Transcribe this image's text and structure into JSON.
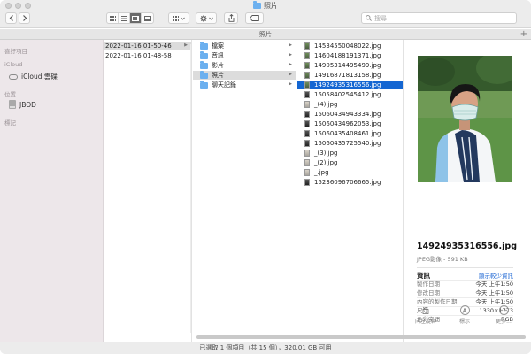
{
  "window": {
    "title": "照片"
  },
  "toolbar": {
    "back_icon": "chevron-left-icon",
    "forward_icon": "chevron-right-icon",
    "view_modes": [
      "icon-view",
      "list-view",
      "column-view",
      "gallery-view"
    ],
    "active_view": "column-view",
    "search_placeholder": "搜尋"
  },
  "pathbar": {
    "title": "照片"
  },
  "sidebar": {
    "sections": [
      {
        "header": "喜好項目",
        "items": []
      },
      {
        "header": "iCloud",
        "items": [
          {
            "label": "iCloud 雲碟",
            "icon": "cloud-icon"
          }
        ]
      },
      {
        "header": "位置",
        "items": [
          {
            "label": "JBOD",
            "icon": "drive-icon"
          }
        ]
      },
      {
        "header": "標記",
        "items": []
      }
    ]
  },
  "column1": {
    "items": [
      {
        "label": "2022-01-16 01-50-46",
        "selected": true
      },
      {
        "label": "2022-01-16 01-48-58",
        "selected": false
      }
    ]
  },
  "column2": {
    "items": [
      {
        "label": "檔案",
        "selected": false
      },
      {
        "label": "音訊",
        "selected": false
      },
      {
        "label": "影片",
        "selected": false
      },
      {
        "label": "照片",
        "selected": true
      },
      {
        "label": "聊天記錄",
        "selected": false
      }
    ]
  },
  "column3": {
    "items": [
      {
        "label": "14534550048022.jpg",
        "thumb": "green"
      },
      {
        "label": "14604188191371.jpg",
        "thumb": "green"
      },
      {
        "label": "14905314495499.jpg",
        "thumb": "green"
      },
      {
        "label": "14916871813158.jpg",
        "thumb": "green"
      },
      {
        "label": "14924935316556.jpg",
        "thumb": "green",
        "selected": true
      },
      {
        "label": "15058402545412.jpg",
        "thumb": "dark"
      },
      {
        "label": "_(4).jpg",
        "thumb": "light"
      },
      {
        "label": "15060434943334.jpg",
        "thumb": "dark"
      },
      {
        "label": "15060434962053.jpg",
        "thumb": "dark"
      },
      {
        "label": "15060435408461.jpg",
        "thumb": "dark"
      },
      {
        "label": "15060435725540.jpg",
        "thumb": "dark"
      },
      {
        "label": "_(3).jpg",
        "thumb": "light"
      },
      {
        "label": "_(2).jpg",
        "thumb": "light"
      },
      {
        "label": "_.jpg",
        "thumb": "light"
      },
      {
        "label": "15236096706665.jpg",
        "thumb": "dark"
      }
    ]
  },
  "preview": {
    "filename": "14924935316556.jpg",
    "subtitle": "JPEG影像 - 591 KB",
    "info_header": "資訊",
    "show_less": "顯示較少資訊",
    "rows": [
      {
        "key": "製作日期",
        "value": "今天 上午1:50"
      },
      {
        "key": "修改日期",
        "value": "今天 上午1:50"
      },
      {
        "key": "內容的製作日期",
        "value": "今天 上午1:50"
      },
      {
        "key": "尺寸",
        "value": "1330×1773"
      },
      {
        "key": "色彩空間",
        "value": "RGB"
      }
    ],
    "actions": [
      {
        "label": "向左旋轉",
        "icon": "rotate-left-icon"
      },
      {
        "label": "標示",
        "icon": "markup-icon"
      },
      {
        "label": "更多...",
        "icon": "more-icon"
      }
    ]
  },
  "status": {
    "text": "已選取 1 個項目（共 15 個），320.01 GB 可用"
  },
  "colors": {
    "selection_blue": "#1466d2",
    "folder_blue": "#6cb0ef",
    "sidebar_bg": "#ede7ea"
  }
}
